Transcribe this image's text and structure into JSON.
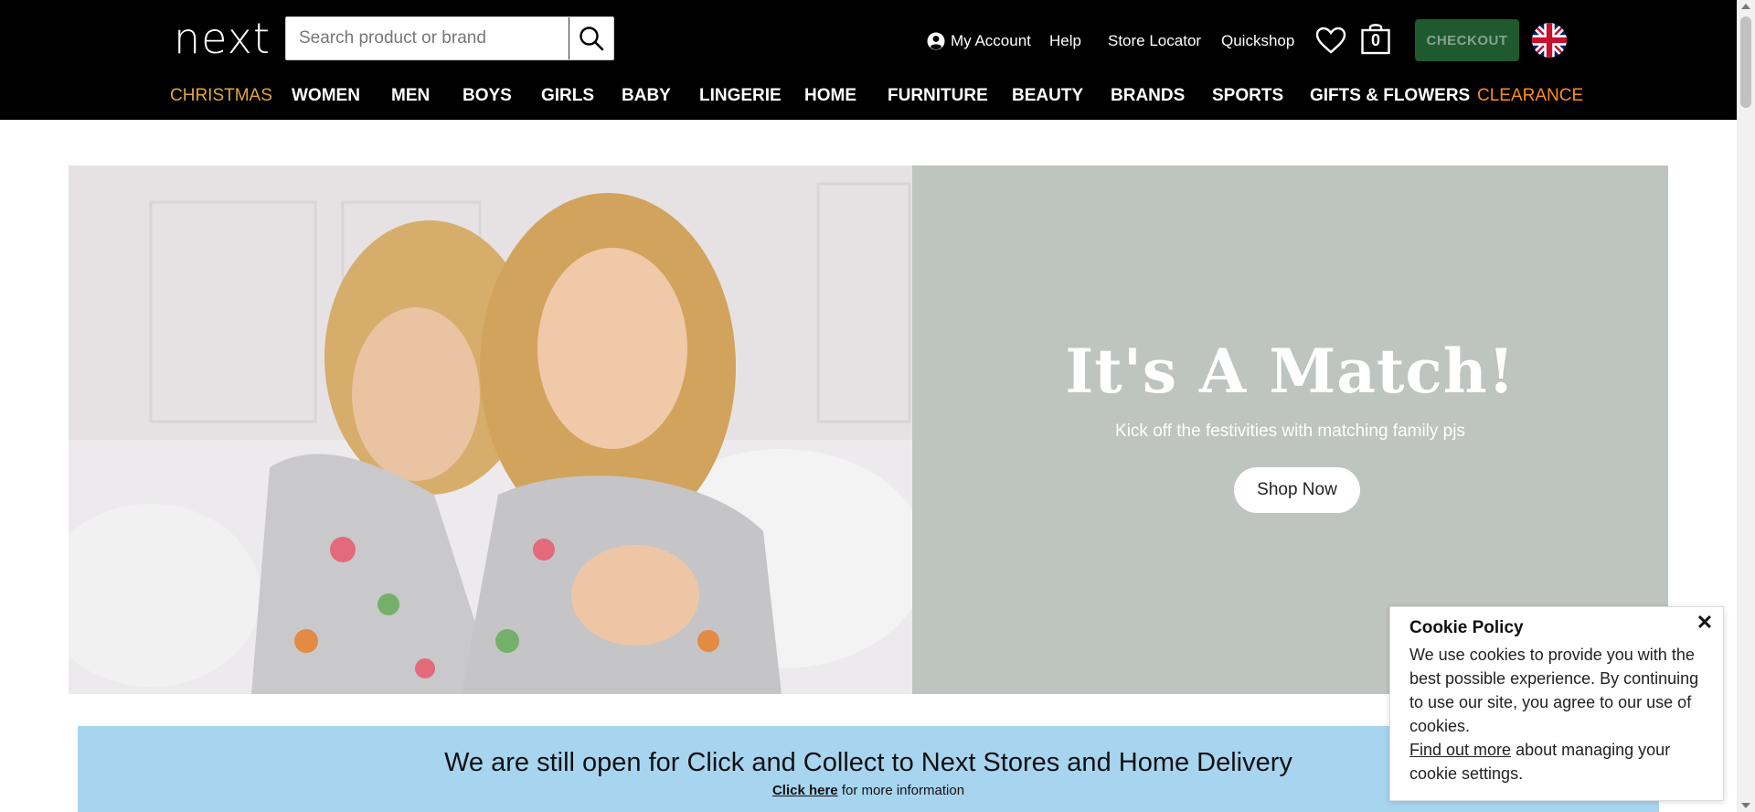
{
  "header": {
    "logo": "next",
    "search_placeholder": "Search product or brand",
    "my_account": "My Account",
    "help": "Help",
    "store_locator": "Store Locator",
    "quickshop": "Quickshop",
    "bag_count": "0",
    "checkout": "CHECKOUT",
    "country_flag": "uk-flag-icon"
  },
  "categories": [
    "CHRISTMAS",
    "WOMEN",
    "MEN",
    "BOYS",
    "GIRLS",
    "BABY",
    "LINGERIE",
    "HOME",
    "FURNITURE",
    "BEAUTY",
    "BRANDS",
    "SPORTS",
    "GIFTS & FLOWERS",
    "CLEARANCE"
  ],
  "hero": {
    "title": "It's A Match!",
    "subtitle": "Kick off the festivities with matching family pjs",
    "button": "Shop Now"
  },
  "banner": {
    "title": "We are still open for Click and Collect to Next Stores and Home Delivery",
    "link": "Click here",
    "suffix": " for more information"
  },
  "cookie": {
    "title": "Cookie Policy",
    "close": "✕",
    "body": "We use cookies to provide you with the best possible experience. By continuing to use our site, you agree to our use of cookies.",
    "link": "Find out more",
    "body_suffix": " about managing your cookie settings."
  },
  "colors": {
    "header_bg": "#000000",
    "checkout_bg": "#1e5a2e",
    "christmas": "#e0a640",
    "clearance": "#ff8c1a",
    "hero_panel": "#bec4bf",
    "banner_bg": "#a7d4ef"
  }
}
